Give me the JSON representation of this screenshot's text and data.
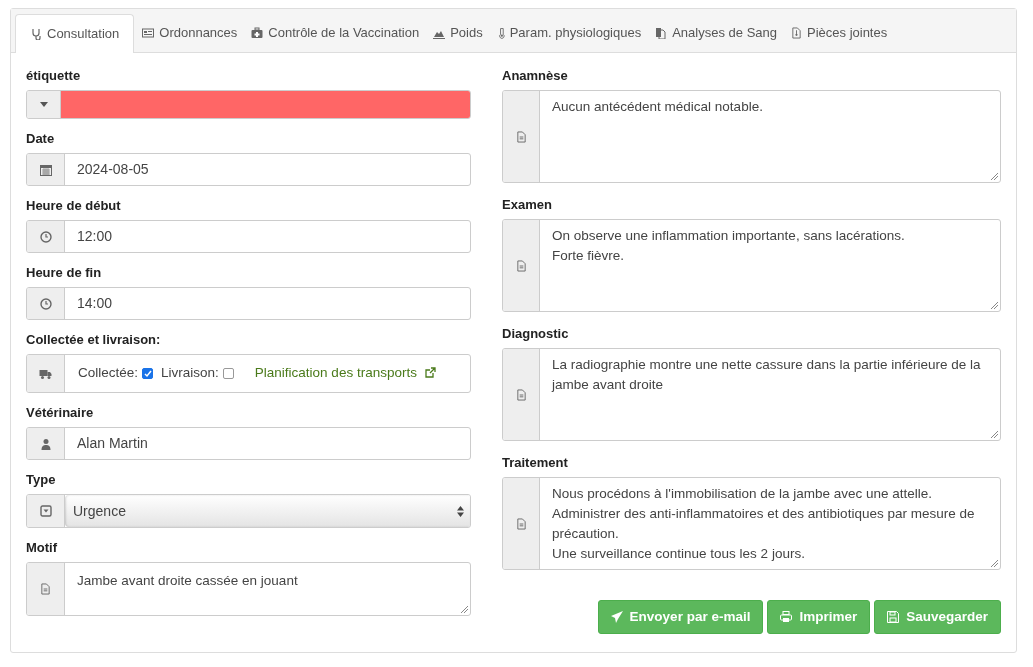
{
  "tabs": [
    {
      "label": "Consultation",
      "selected": true
    },
    {
      "label": "Ordonnances",
      "selected": false
    },
    {
      "label": "Contrôle de la Vaccination",
      "selected": false
    },
    {
      "label": "Poids",
      "selected": false
    },
    {
      "label": "Param. physiologiques",
      "selected": false
    },
    {
      "label": "Analyses de Sang",
      "selected": false
    },
    {
      "label": "Pièces jointes",
      "selected": false
    }
  ],
  "left_fields": [
    {
      "kind": "color",
      "label": "étiquette",
      "color": "#ff6666"
    },
    {
      "kind": "text",
      "label": "Date",
      "value": "2024-08-05"
    },
    {
      "kind": "text",
      "label": "Heure de début",
      "value": "12:00"
    },
    {
      "kind": "text",
      "label": "Heure de fin",
      "value": "14:00"
    },
    {
      "kind": "transport",
      "label": "Collectée et livraison:",
      "collected": {
        "label": "Collectée:",
        "checked": true
      },
      "delivery": {
        "label": "Livraison:",
        "checked": false
      },
      "link": "Planification des transports"
    },
    {
      "kind": "text",
      "label": "Vétérinaire",
      "value": "Alan Martin"
    },
    {
      "kind": "select",
      "label": "Type",
      "value": "Urgence"
    },
    {
      "kind": "textarea",
      "label": "Motif",
      "value": "Jambe avant droite cassée en jouant"
    }
  ],
  "right_fields": [
    {
      "label": "Anamnèse",
      "value": "Aucun antécédent médical notable."
    },
    {
      "label": "Examen",
      "value": "On observe une inflammation importante, sans lacérations.\nForte fièvre."
    },
    {
      "label": "Diagnostic",
      "value": "La radiographie montre une nette cassure dans la partie inférieure de la jambe avant droite"
    },
    {
      "label": "Traitement",
      "value": "Nous procédons à l'immobilisation de la jambe avec une attelle.\nAdministrer des anti-inflammatoires et des antibiotiques par mesure de précaution.\nUne surveillance continue tous les 2 jours."
    }
  ],
  "buttons": [
    "Envoyer par e-mail",
    "Imprimer",
    "Sauvegarder"
  ]
}
